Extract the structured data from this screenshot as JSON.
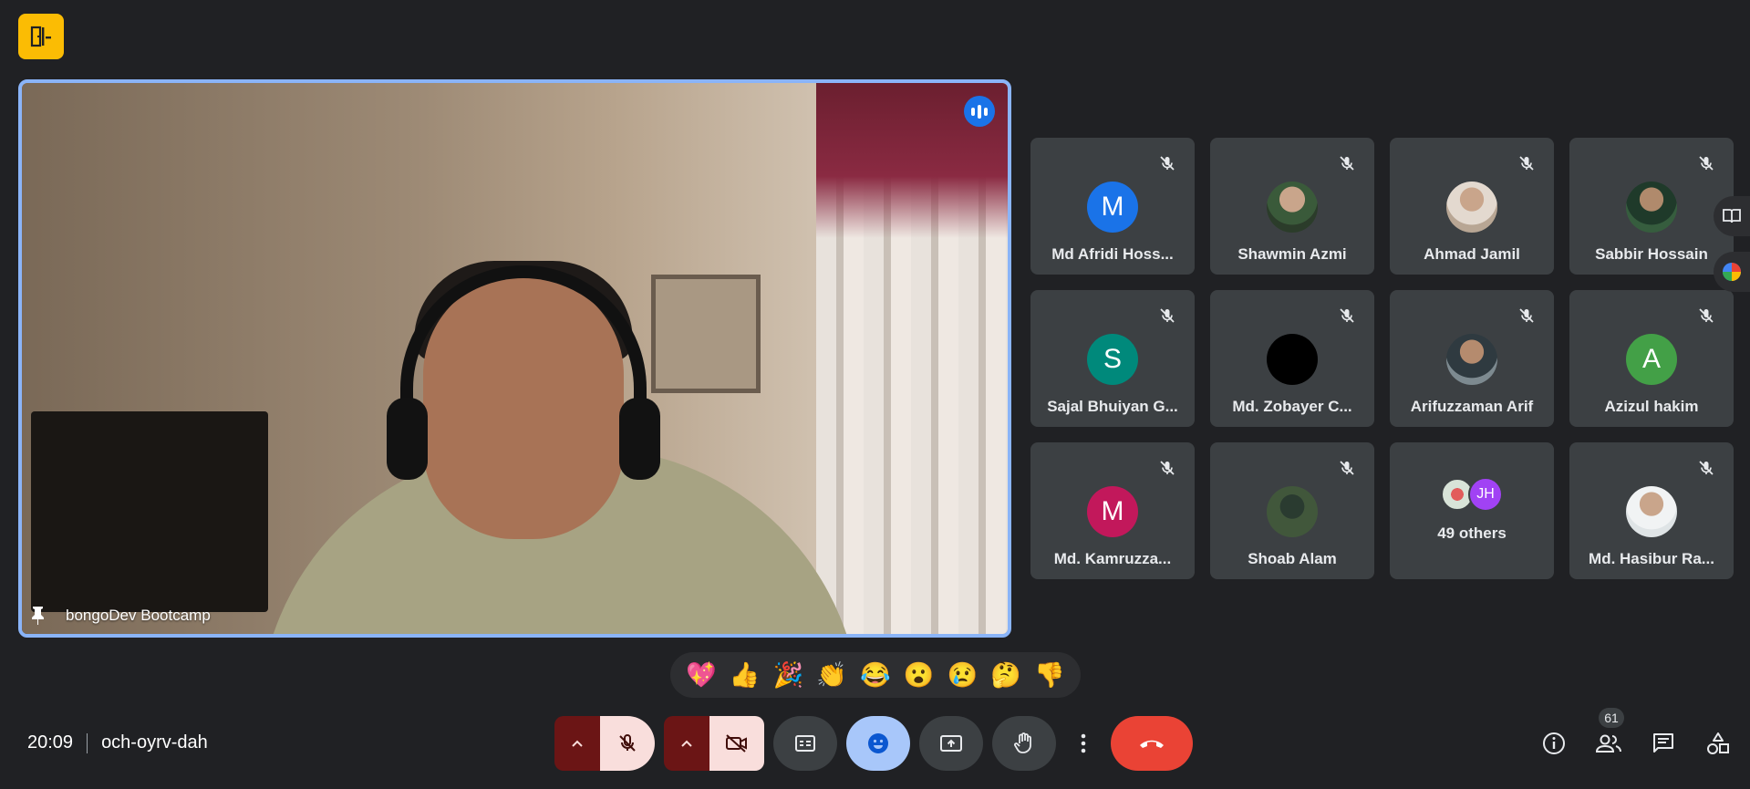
{
  "main_video": {
    "participant_name": "bongoDev Bootcamp",
    "speaking": true
  },
  "participants": [
    {
      "name": "Md Afridi Hoss...",
      "avatar_letter": "M",
      "avatar_color": "#1a73e8",
      "muted": true
    },
    {
      "name": "Shawmin Azmi",
      "avatar_letter": "",
      "avatar_color": "",
      "muted": true
    },
    {
      "name": "Ahmad Jamil",
      "avatar_letter": "",
      "avatar_color": "",
      "muted": true
    },
    {
      "name": "Sabbir Hossain",
      "avatar_letter": "",
      "avatar_color": "",
      "muted": true
    },
    {
      "name": "Sajal Bhuiyan G...",
      "avatar_letter": "S",
      "avatar_color": "#00897b",
      "muted": true
    },
    {
      "name": "Md. Zobayer C...",
      "avatar_letter": "",
      "avatar_color": "#000000",
      "muted": true
    },
    {
      "name": "Arifuzzaman Arif",
      "avatar_letter": "",
      "avatar_color": "",
      "muted": true
    },
    {
      "name": "Azizul hakim",
      "avatar_letter": "A",
      "avatar_color": "#43a047",
      "muted": true
    },
    {
      "name": "Md. Kamruzza...",
      "avatar_letter": "M",
      "avatar_color": "#c2185b",
      "muted": true
    },
    {
      "name": "Shoab Alam",
      "avatar_letter": "",
      "avatar_color": "",
      "muted": true
    },
    {
      "name": "49 others",
      "avatar_letter": "JH",
      "avatar_color": "#a142f4",
      "muted": false
    },
    {
      "name": "Md. Hasibur Ra...",
      "avatar_letter": "",
      "avatar_color": "",
      "muted": true
    }
  ],
  "reactions": [
    "💖",
    "👍",
    "🎉",
    "👏",
    "😂",
    "😮",
    "😢",
    "🤔",
    "👎"
  ],
  "meeting": {
    "time": "20:09",
    "code": "och-oyrv-dah"
  },
  "people_count": "61",
  "colors": {
    "background": "#202124",
    "tile": "#3c4043",
    "accent": "#8ab4f8",
    "hangup": "#ea4335",
    "muted_bg": "#f9dedc"
  }
}
